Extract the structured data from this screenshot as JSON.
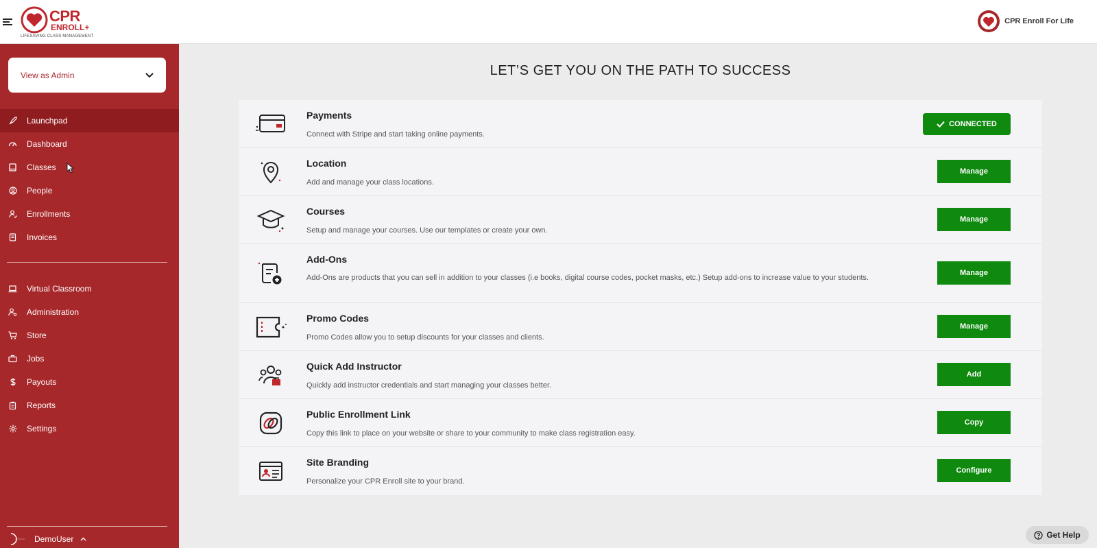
{
  "brand": {
    "logo_line1": "CPR",
    "logo_line2": "ENROLL+",
    "tagline": "LIFESAVING CLASS MANAGEMENT",
    "primary_color": "#a7282b",
    "button_color": "#0f8a0f"
  },
  "header": {
    "menu_icon": "hamburger-icon",
    "org_name": "CPR Enroll For Life"
  },
  "sidebar": {
    "view_select": "View as Admin",
    "primary_items": [
      {
        "label": "Launchpad",
        "icon": "rocket-icon",
        "active": true
      },
      {
        "label": "Dashboard",
        "icon": "gauge-icon"
      },
      {
        "label": "Classes",
        "icon": "book-icon"
      },
      {
        "label": "People",
        "icon": "person-circle-icon"
      },
      {
        "label": "Enrollments",
        "icon": "person-check-icon"
      },
      {
        "label": "Invoices",
        "icon": "invoice-icon"
      }
    ],
    "secondary_items": [
      {
        "label": "Virtual Classroom",
        "icon": "laptop-icon"
      },
      {
        "label": "Administration",
        "icon": "admin-icon"
      },
      {
        "label": "Store",
        "icon": "cart-icon"
      },
      {
        "label": "Jobs",
        "icon": "briefcase-icon"
      },
      {
        "label": "Payouts",
        "icon": "dollar-icon"
      },
      {
        "label": "Reports",
        "icon": "clipboard-icon"
      },
      {
        "label": "Settings",
        "icon": "gear-icon"
      }
    ],
    "user_name": "DemoUser"
  },
  "main": {
    "title": "LET’S GET YOU ON THE PATH TO SUCCESS",
    "steps": [
      {
        "title": "Payments",
        "desc": "Connect with Stripe and start taking online payments.",
        "button": "CONNECTED",
        "icon": "credit-card-icon"
      },
      {
        "title": "Location",
        "desc": "Add and manage your class locations.",
        "button": "Manage",
        "icon": "map-pin-icon"
      },
      {
        "title": "Courses",
        "desc": "Setup and manage your courses. Use our templates or create your own.",
        "button": "Manage",
        "icon": "graduation-cap-icon"
      },
      {
        "title": "Add-Ons",
        "desc": "Add-Ons are products that you can sell in addition to your classes (i.e books, digital course codes, pocket masks, etc.) Setup add-ons to increase value to your students.",
        "button": "Manage",
        "icon": "add-list-icon"
      },
      {
        "title": "Promo Codes",
        "desc": "Promo Codes allow you to setup discounts for your classes and clients.",
        "button": "Manage",
        "icon": "ticket-icon"
      },
      {
        "title": "Quick Add Instructor",
        "desc": "Quickly add instructor credentials and start managing your classes better.",
        "button": "Add",
        "icon": "instructor-group-icon"
      },
      {
        "title": "Public Enrollment Link",
        "desc": "Copy this link to place on your website or share to your community to make class registration easy.",
        "button": "Copy",
        "icon": "link-icon"
      },
      {
        "title": "Site Branding",
        "desc": "Personalize your CPR Enroll site to your brand.",
        "button": "Configure",
        "icon": "id-card-icon"
      }
    ]
  },
  "help": {
    "label": "Get Help",
    "icon": "question-circle-icon"
  }
}
